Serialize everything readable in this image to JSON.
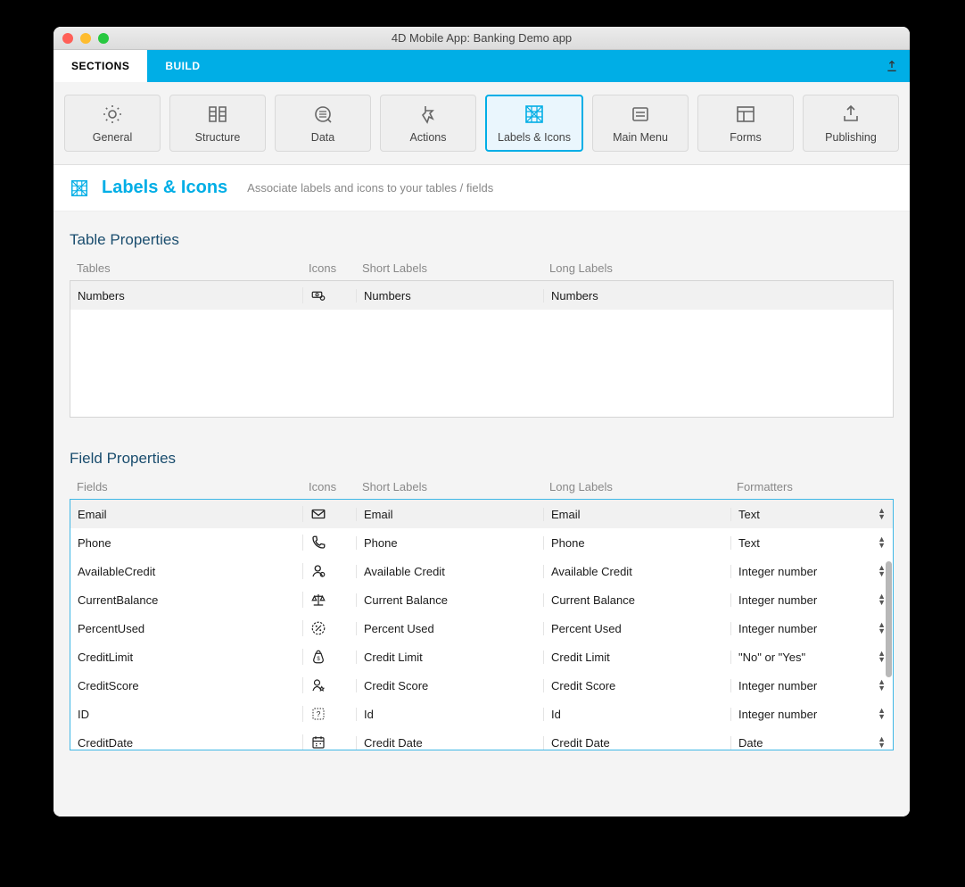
{
  "window": {
    "title": "4D Mobile App: Banking Demo app"
  },
  "topTabs": {
    "sections": "SECTIONS",
    "build": "BUILD"
  },
  "sectionButtons": [
    {
      "label": "General",
      "icon": "gear-icon"
    },
    {
      "label": "Structure",
      "icon": "structure-icon"
    },
    {
      "label": "Data",
      "icon": "data-icon"
    },
    {
      "label": "Actions",
      "icon": "actions-icon"
    },
    {
      "label": "Labels & Icons",
      "icon": "labels-icon"
    },
    {
      "label": "Main Menu",
      "icon": "menu-icon"
    },
    {
      "label": "Forms",
      "icon": "forms-icon"
    },
    {
      "label": "Publishing",
      "icon": "publish-icon"
    }
  ],
  "heading": {
    "title": "Labels & Icons",
    "desc": "Associate labels and icons to your tables / fields"
  },
  "tableProps": {
    "title": "Table Properties",
    "columns": {
      "tables": "Tables",
      "icons": "Icons",
      "short": "Short Labels",
      "long": "Long Labels"
    },
    "rows": [
      {
        "name": "Numbers",
        "icon": "money-icon",
        "short": "Numbers",
        "long": "Numbers"
      }
    ]
  },
  "fieldProps": {
    "title": "Field Properties",
    "columns": {
      "fields": "Fields",
      "icons": "Icons",
      "short": "Short Labels",
      "long": "Long Labels",
      "formatters": "Formatters"
    },
    "rows": [
      {
        "name": "Email",
        "icon": "mail-icon",
        "short": "Email",
        "long": "Email",
        "fmt": "Text"
      },
      {
        "name": "Phone",
        "icon": "phone-icon",
        "short": "Phone",
        "long": "Phone",
        "fmt": "Text"
      },
      {
        "name": "AvailableCredit",
        "icon": "person-icon",
        "short": "Available Credit",
        "long": "Available Credit",
        "fmt": "Integer number"
      },
      {
        "name": "CurrentBalance",
        "icon": "scale-icon",
        "short": "Current Balance",
        "long": "Current Balance",
        "fmt": "Integer number"
      },
      {
        "name": "PercentUsed",
        "icon": "percent-icon",
        "short": "Percent Used",
        "long": "Percent Used",
        "fmt": "Integer number"
      },
      {
        "name": "CreditLimit",
        "icon": "bag-icon",
        "short": "Credit Limit",
        "long": "Credit Limit",
        "fmt": "\"No\" or \"Yes\""
      },
      {
        "name": "CreditScore",
        "icon": "badge-icon",
        "short": "Credit Score",
        "long": "Credit Score",
        "fmt": "Integer number"
      },
      {
        "name": "ID",
        "icon": "question-icon",
        "short": "Id",
        "long": "Id",
        "fmt": "Integer number"
      },
      {
        "name": "CreditDate",
        "icon": "calendar-icon",
        "short": "Credit Date",
        "long": "Credit Date",
        "fmt": "Date"
      }
    ]
  }
}
